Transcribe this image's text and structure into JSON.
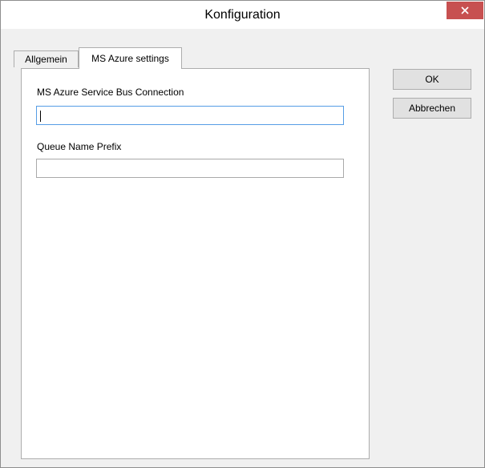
{
  "window": {
    "title": "Konfiguration",
    "close_icon": "close-icon",
    "accent_close": "#c75050"
  },
  "tabs": [
    {
      "label": "Allgemein",
      "active": false
    },
    {
      "label": "MS Azure settings",
      "active": true
    }
  ],
  "form": {
    "connection_label": "MS Azure Service Bus Connection",
    "connection_value": "",
    "prefix_label": "Queue Name Prefix",
    "prefix_value": ""
  },
  "buttons": {
    "ok_label": "OK",
    "cancel_label": "Abbrechen"
  }
}
